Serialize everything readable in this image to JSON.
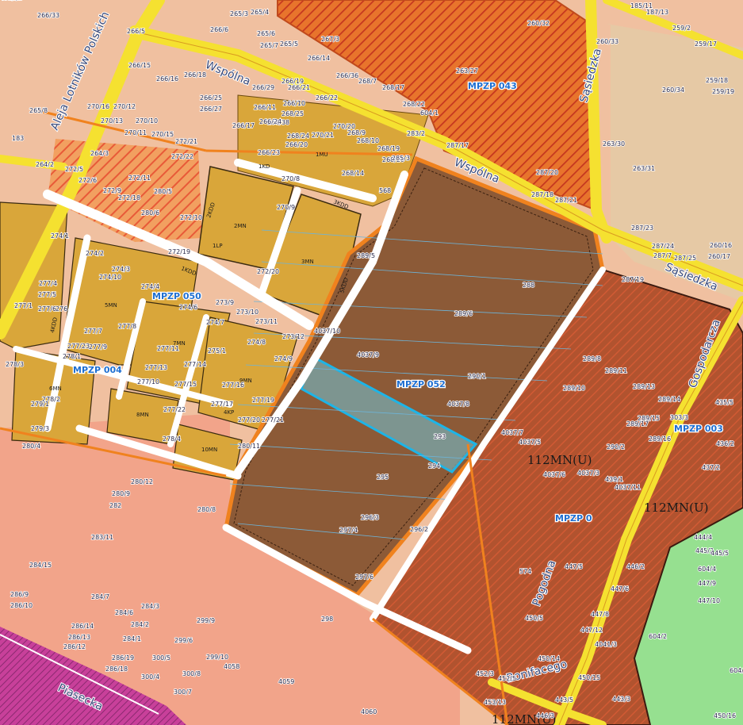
{
  "map": {
    "plan_labels": [
      "MPZP 043",
      "MPZP 050",
      "MPZP 004",
      "MPZP 052",
      "MPZP 003",
      "MPZP 0"
    ],
    "streets": [
      "Wspólna",
      "Wspólna",
      "Sąsiedzka",
      "Sąsiedzka",
      "Aleja Lotników Polskich",
      "Gospodarcza",
      "Piasecka",
      "Bonifacego",
      "Pogodna"
    ],
    "zone_labels": [
      "2MN",
      "1LP",
      "3MN",
      "5MN",
      "7MN",
      "9MN",
      "6MN",
      "8MN",
      "10MN",
      "4KP",
      "1KDD",
      "2KDD",
      "3KDD",
      "4KDD",
      "5KDD",
      "1MU",
      "1KD"
    ],
    "big_zone_labels": [
      "112MN(U)",
      "112MN(U)",
      "112MN(U)"
    ],
    "parcels": [
      "260/32",
      "263/27",
      "265/3",
      "265/4",
      "265/5",
      "265/6",
      "265/7",
      "267/3",
      "266/14",
      "266/36",
      "268/7",
      "268/17",
      "268/22",
      "604/1",
      "287/17",
      "287/20",
      "287/18",
      "287/21",
      "263/30",
      "263/31",
      "260/33",
      "260/34",
      "287/23",
      "287/24",
      "287/25",
      "287/7",
      "287/19",
      "288",
      "289/5",
      "289/6",
      "4037/10",
      "4037/9",
      "290/1",
      "4037/8",
      "293",
      "294",
      "295",
      "296/3",
      "296/2",
      "297/4",
      "297/6",
      "4037/7",
      "4037/5",
      "4037/6",
      "4037/3",
      "4037/11",
      "289/8",
      "289/10",
      "289/11",
      "289/13",
      "289/14",
      "289/15",
      "289/16",
      "289/17",
      "290/2",
      "303/3",
      "435/5",
      "436/2",
      "437/2",
      "439/1",
      "444/4",
      "445/2",
      "445/5",
      "446/2",
      "447/5",
      "447/6",
      "447/8",
      "447/12",
      "4041/3",
      "450/5",
      "450/14",
      "450/15",
      "452/3",
      "452/5",
      "453/13",
      "574",
      "280/11",
      "280/12",
      "280/8",
      "280/9",
      "282",
      "283/11",
      "284/15",
      "284/7",
      "284/6",
      "284/3",
      "284/2",
      "284/1",
      "286/9",
      "286/10",
      "286/14",
      "286/13",
      "286/12",
      "286/19",
      "286/18",
      "299/9",
      "299/6",
      "299/10",
      "298",
      "300/5",
      "300/4",
      "300/7",
      "300/8",
      "4058",
      "4059",
      "4060",
      "270/8",
      "270/9",
      "272/19",
      "272/20",
      "273/9",
      "273/10",
      "273/11",
      "273/12",
      "274/1",
      "274/2",
      "274/3",
      "274/4",
      "274/6",
      "274/7",
      "274/8",
      "274/9",
      "274/10",
      "275/1",
      "276",
      "277/1",
      "277/4",
      "277/5",
      "277/6",
      "277/7",
      "277/8",
      "277/9",
      "277/10",
      "277/11",
      "277/13",
      "277/14",
      "277/15",
      "277/16",
      "277/17",
      "277/19",
      "277/20",
      "277/21",
      "277/22",
      "277/23",
      "278/1",
      "278/2",
      "278/3",
      "278/4",
      "279/1",
      "279/3",
      "280/4",
      "280/5",
      "280/6",
      "272/5",
      "272/6",
      "272/9",
      "272/10",
      "272/11",
      "272/18",
      "272/21",
      "272/22",
      "270/10",
      "270/11",
      "270/12",
      "270/13",
      "270/15",
      "270/16",
      "270/20",
      "270/21",
      "268/9",
      "268/10",
      "268/14",
      "268/19",
      "268/20",
      "268/24",
      "268/25",
      "268/38",
      "266/20",
      "266/23",
      "266/24",
      "266/25",
      "266/27",
      "266/29",
      "266/10",
      "266/11",
      "266/17",
      "266/19",
      "266/21",
      "266/22",
      "266/15",
      "266/16",
      "266/18",
      "266/5",
      "266/6",
      "266/33",
      "265/8",
      "183",
      "185/11",
      "187/13",
      "259/2",
      "259/17",
      "259/18",
      "259/19",
      "260/16",
      "260/17",
      "264/2",
      "264/3",
      "283/2",
      "285/3",
      "568",
      "604/2",
      "604/3",
      "604/4",
      "447/9",
      "447/10",
      "443/5",
      "443/3",
      "446/3",
      "450/16",
      "450/17",
      "452/6",
      "4041/2"
    ]
  },
  "colors": {
    "residential": "#d9a63a",
    "service": "#f2a68a",
    "development": "#8c5a37",
    "industrial_hatch": "#b1532f",
    "road_major": "#f5e130",
    "road_local": "#ffffff",
    "green": "#96e090",
    "rail": "#c83a8a",
    "highlight": "#1eb4e6",
    "boundary": "#f0821e"
  }
}
